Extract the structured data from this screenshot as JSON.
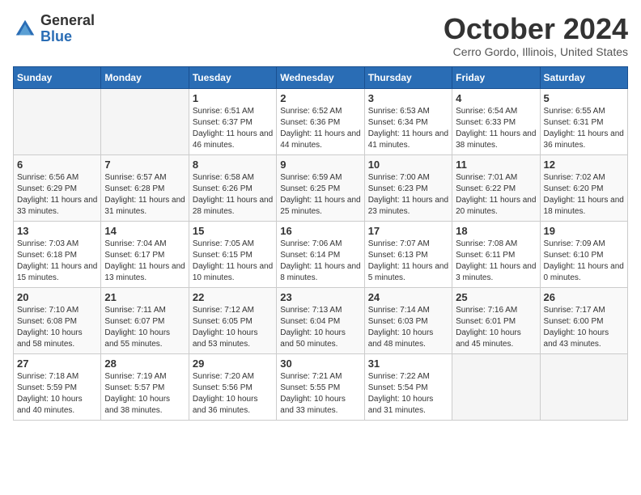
{
  "header": {
    "logo_general": "General",
    "logo_blue": "Blue",
    "month": "October 2024",
    "location": "Cerro Gordo, Illinois, United States"
  },
  "days_of_week": [
    "Sunday",
    "Monday",
    "Tuesday",
    "Wednesday",
    "Thursday",
    "Friday",
    "Saturday"
  ],
  "weeks": [
    [
      {
        "day": "",
        "empty": true
      },
      {
        "day": "",
        "empty": true
      },
      {
        "day": "1",
        "sunrise": "6:51 AM",
        "sunset": "6:37 PM",
        "daylight": "11 hours and 46 minutes."
      },
      {
        "day": "2",
        "sunrise": "6:52 AM",
        "sunset": "6:36 PM",
        "daylight": "11 hours and 44 minutes."
      },
      {
        "day": "3",
        "sunrise": "6:53 AM",
        "sunset": "6:34 PM",
        "daylight": "11 hours and 41 minutes."
      },
      {
        "day": "4",
        "sunrise": "6:54 AM",
        "sunset": "6:33 PM",
        "daylight": "11 hours and 38 minutes."
      },
      {
        "day": "5",
        "sunrise": "6:55 AM",
        "sunset": "6:31 PM",
        "daylight": "11 hours and 36 minutes."
      }
    ],
    [
      {
        "day": "6",
        "sunrise": "6:56 AM",
        "sunset": "6:29 PM",
        "daylight": "11 hours and 33 minutes."
      },
      {
        "day": "7",
        "sunrise": "6:57 AM",
        "sunset": "6:28 PM",
        "daylight": "11 hours and 31 minutes."
      },
      {
        "day": "8",
        "sunrise": "6:58 AM",
        "sunset": "6:26 PM",
        "daylight": "11 hours and 28 minutes."
      },
      {
        "day": "9",
        "sunrise": "6:59 AM",
        "sunset": "6:25 PM",
        "daylight": "11 hours and 25 minutes."
      },
      {
        "day": "10",
        "sunrise": "7:00 AM",
        "sunset": "6:23 PM",
        "daylight": "11 hours and 23 minutes."
      },
      {
        "day": "11",
        "sunrise": "7:01 AM",
        "sunset": "6:22 PM",
        "daylight": "11 hours and 20 minutes."
      },
      {
        "day": "12",
        "sunrise": "7:02 AM",
        "sunset": "6:20 PM",
        "daylight": "11 hours and 18 minutes."
      }
    ],
    [
      {
        "day": "13",
        "sunrise": "7:03 AM",
        "sunset": "6:18 PM",
        "daylight": "11 hours and 15 minutes."
      },
      {
        "day": "14",
        "sunrise": "7:04 AM",
        "sunset": "6:17 PM",
        "daylight": "11 hours and 13 minutes."
      },
      {
        "day": "15",
        "sunrise": "7:05 AM",
        "sunset": "6:15 PM",
        "daylight": "11 hours and 10 minutes."
      },
      {
        "day": "16",
        "sunrise": "7:06 AM",
        "sunset": "6:14 PM",
        "daylight": "11 hours and 8 minutes."
      },
      {
        "day": "17",
        "sunrise": "7:07 AM",
        "sunset": "6:13 PM",
        "daylight": "11 hours and 5 minutes."
      },
      {
        "day": "18",
        "sunrise": "7:08 AM",
        "sunset": "6:11 PM",
        "daylight": "11 hours and 3 minutes."
      },
      {
        "day": "19",
        "sunrise": "7:09 AM",
        "sunset": "6:10 PM",
        "daylight": "11 hours and 0 minutes."
      }
    ],
    [
      {
        "day": "20",
        "sunrise": "7:10 AM",
        "sunset": "6:08 PM",
        "daylight": "10 hours and 58 minutes."
      },
      {
        "day": "21",
        "sunrise": "7:11 AM",
        "sunset": "6:07 PM",
        "daylight": "10 hours and 55 minutes."
      },
      {
        "day": "22",
        "sunrise": "7:12 AM",
        "sunset": "6:05 PM",
        "daylight": "10 hours and 53 minutes."
      },
      {
        "day": "23",
        "sunrise": "7:13 AM",
        "sunset": "6:04 PM",
        "daylight": "10 hours and 50 minutes."
      },
      {
        "day": "24",
        "sunrise": "7:14 AM",
        "sunset": "6:03 PM",
        "daylight": "10 hours and 48 minutes."
      },
      {
        "day": "25",
        "sunrise": "7:16 AM",
        "sunset": "6:01 PM",
        "daylight": "10 hours and 45 minutes."
      },
      {
        "day": "26",
        "sunrise": "7:17 AM",
        "sunset": "6:00 PM",
        "daylight": "10 hours and 43 minutes."
      }
    ],
    [
      {
        "day": "27",
        "sunrise": "7:18 AM",
        "sunset": "5:59 PM",
        "daylight": "10 hours and 40 minutes."
      },
      {
        "day": "28",
        "sunrise": "7:19 AM",
        "sunset": "5:57 PM",
        "daylight": "10 hours and 38 minutes."
      },
      {
        "day": "29",
        "sunrise": "7:20 AM",
        "sunset": "5:56 PM",
        "daylight": "10 hours and 36 minutes."
      },
      {
        "day": "30",
        "sunrise": "7:21 AM",
        "sunset": "5:55 PM",
        "daylight": "10 hours and 33 minutes."
      },
      {
        "day": "31",
        "sunrise": "7:22 AM",
        "sunset": "5:54 PM",
        "daylight": "10 hours and 31 minutes."
      },
      {
        "day": "",
        "empty": true
      },
      {
        "day": "",
        "empty": true
      }
    ]
  ]
}
